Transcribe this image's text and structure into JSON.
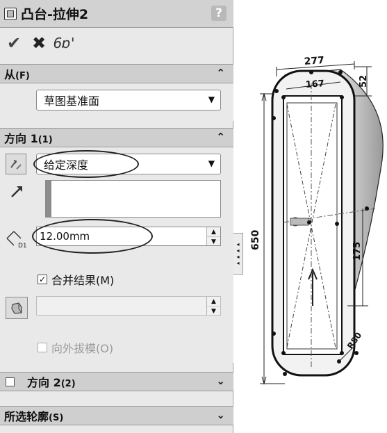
{
  "property_manager": {
    "title": "凸台-拉伸2",
    "help_label": "?",
    "actions": {
      "ok": "✔",
      "cancel": "✖",
      "preview": "6ɒ'"
    },
    "from": {
      "header": "从",
      "header_key": "(F)",
      "start_condition": "草图基准面"
    },
    "direction1": {
      "header": "方向 1",
      "header_key": "(1)",
      "end_condition": "给定深度",
      "depth": "12.00mm",
      "depth_icon_label": "D1",
      "merge_result": {
        "label": "合并结果(M)",
        "checked": true
      },
      "draft_outward": {
        "label": "向外拔模(O)",
        "checked": false,
        "enabled": false
      }
    },
    "direction2": {
      "header": "方向 2",
      "header_key": "(2)",
      "checked": false
    },
    "selected_contours": {
      "header": "所选轮廓",
      "header_key": "(S)"
    }
  },
  "model_view": {
    "dimensions": {
      "overall_height": "650",
      "outer_width": "277",
      "inner_width": "167",
      "top_offset": "52",
      "inner_segment": "175",
      "corner_radius": "R80"
    }
  }
}
